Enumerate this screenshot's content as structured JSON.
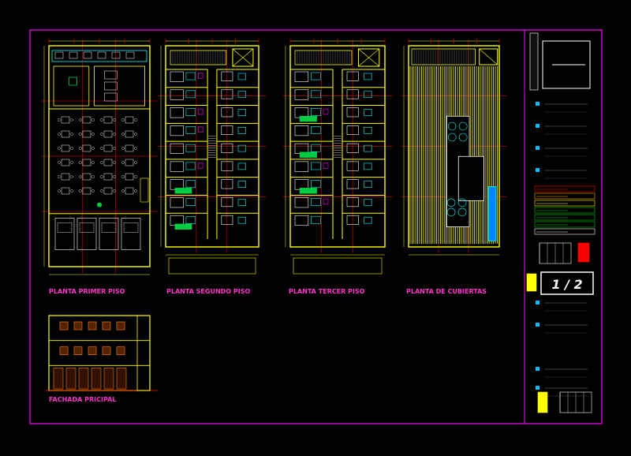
{
  "sheet": {
    "drawing_labels": {
      "first_floor": "PLANTA PRIMER PISO",
      "second_floor": "PLANTA SEGUNDO PISO",
      "third_floor": "PLANTA TERCER PISO",
      "roof": "PLANTA DE CUBIERTAS",
      "facade": "FACHADA PRICIPAL"
    },
    "sheet_number": "1 / 2",
    "colors": {
      "frame": "#ff00ff",
      "walls": "#ffff00",
      "grid": "#ff0000",
      "furniture": "#ffffff",
      "fixtures": "#00ffff",
      "green": "#00cc44",
      "labels": "#ff33cc",
      "title_block_bullets": "#00bfff"
    }
  }
}
